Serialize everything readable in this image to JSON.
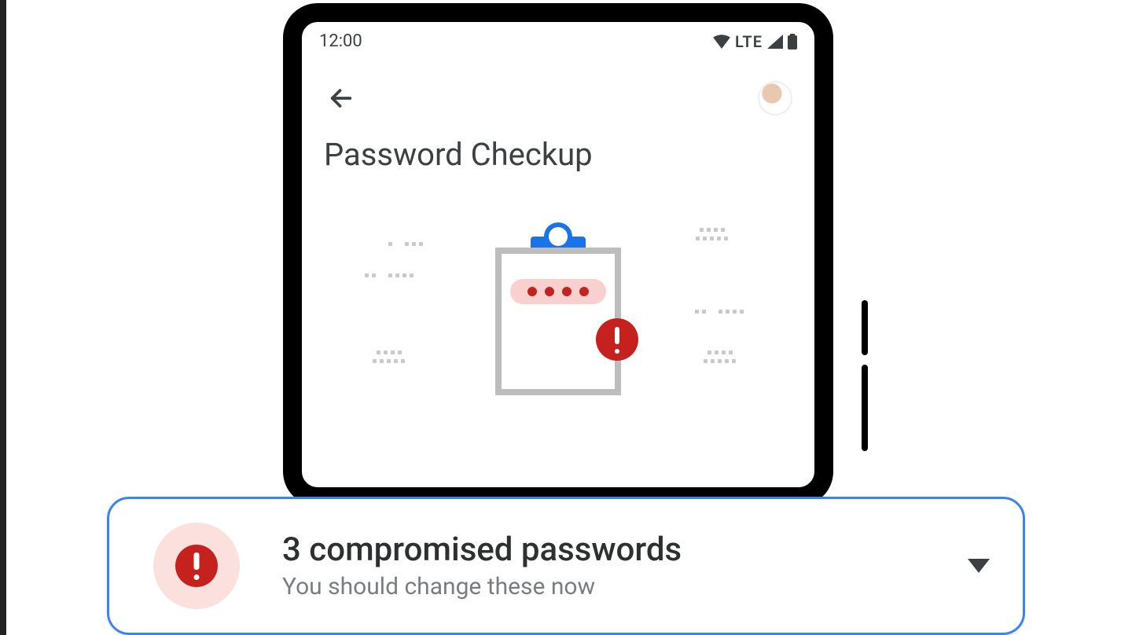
{
  "status_bar": {
    "time": "12:00",
    "network_label": "LTE"
  },
  "header": {
    "title": "Password Checkup"
  },
  "illustration": {
    "icon": "clipboard-password-alert"
  },
  "alert_card": {
    "title": "3 compromised passwords",
    "subtitle": "You should change these now"
  },
  "colors": {
    "accent_blue": "#1a73e8",
    "alert_red": "#c5221f",
    "card_border": "#3b82f6",
    "text_primary": "#2d2f31",
    "text_secondary": "#7a7d80"
  }
}
